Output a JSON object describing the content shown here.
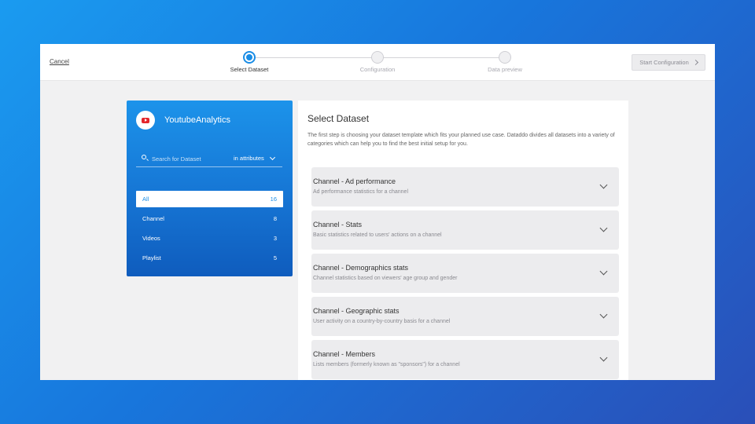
{
  "topbar": {
    "cancel_label": "Cancel",
    "steps": [
      {
        "label": "Select Dataset",
        "active": true
      },
      {
        "label": "Configuration",
        "active": false
      },
      {
        "label": "Data preview",
        "active": false
      }
    ],
    "start_button_label": "Start Configuration"
  },
  "sidebar": {
    "app_name": "YoutubeAnalytics",
    "search_placeholder": "Search for Dataset",
    "attribute_select": "in attributes",
    "categories": [
      {
        "label": "All",
        "count": "16",
        "active": true
      },
      {
        "label": "Channel",
        "count": "8",
        "active": false
      },
      {
        "label": "Videos",
        "count": "3",
        "active": false
      },
      {
        "label": "Playlist",
        "count": "5",
        "active": false
      }
    ]
  },
  "main": {
    "title": "Select Dataset",
    "description": "The first step is choosing your dataset template which fits your planned use case. Dataddo divides all datasets into a variety of categories which can help you to find the best initial setup for you.",
    "datasets": [
      {
        "title": "Channel - Ad performance",
        "subtitle": "Ad performance statistics for a channel"
      },
      {
        "title": "Channel - Stats",
        "subtitle": "Basic statistics related to users' actions on a channel"
      },
      {
        "title": "Channel - Demographics stats",
        "subtitle": "Channel statistics based on viewers' age group and gender"
      },
      {
        "title": "Channel - Geographic stats",
        "subtitle": "User activity on a country-by-country basis for a channel"
      },
      {
        "title": "Channel - Members",
        "subtitle": "Lists members (formerly known as \"sponsors\") for a channel"
      }
    ]
  },
  "colors": {
    "accent": "#1a8de6",
    "youtube_red": "#e4262c"
  }
}
